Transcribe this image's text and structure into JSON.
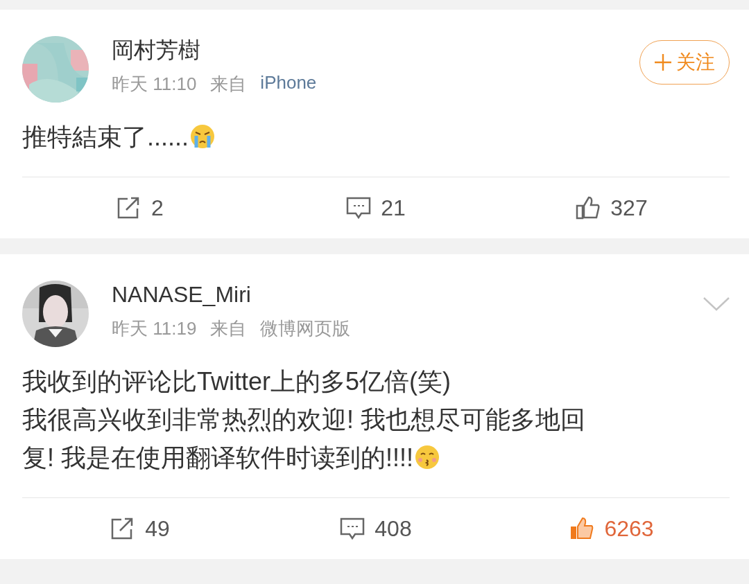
{
  "posts": [
    {
      "author": "岡村芳樹",
      "time": "昨天 11:10",
      "source_label": "来自",
      "source": "iPhone",
      "source_link": true,
      "action": {
        "kind": "follow",
        "label": "关注"
      },
      "lines": [
        "推特結束了......"
      ],
      "emoji": {
        "kind": "crying"
      },
      "reposts": "2",
      "comments": "21",
      "likes": "327",
      "liked": false
    },
    {
      "author": "NANASE_Miri",
      "time": "昨天 11:19",
      "source_label": "来自",
      "source": "微博网页版",
      "source_link": false,
      "action": {
        "kind": "chevron"
      },
      "lines": [
        "我收到的评论比Twitter上的多5亿倍(笑)",
        "我很高兴收到非常热烈的欢迎! 我也想尽可能多地回",
        "复! 我是在使用翻译软件时读到的!!!!"
      ],
      "emoji": {
        "kind": "kiss"
      },
      "reposts": "49",
      "comments": "408",
      "likes": "6263",
      "liked": true
    }
  ]
}
